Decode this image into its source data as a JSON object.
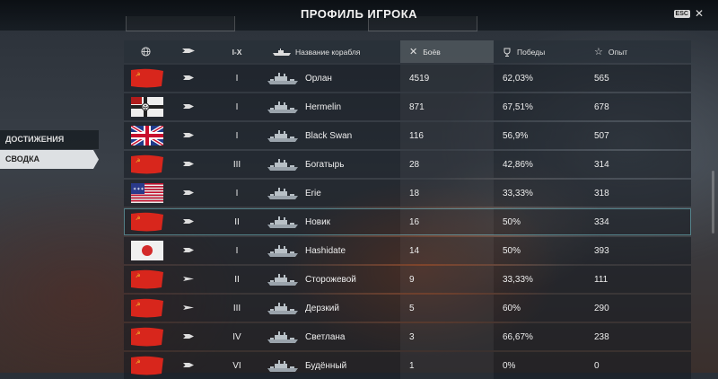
{
  "header": {
    "title": "ПРОФИЛЬ ИГРОКА",
    "esc_label": "ESC",
    "close_icon": "close-icon"
  },
  "sidebar": {
    "items": [
      {
        "label": "ДОСТИЖЕНИЯ"
      },
      {
        "label": "СВОДКА",
        "active": true
      }
    ]
  },
  "table": {
    "columns": {
      "nation": "globe-icon",
      "type": "ship-type-icon",
      "tier": "I-X",
      "ship_icon": "ship-silhouette-icon",
      "name": "Название корабля",
      "battles": "Боёв",
      "wins": "Победы",
      "xp": "Опыт"
    },
    "rows": [
      {
        "flag": "ussr",
        "type": "cruiser",
        "tier": "I",
        "name": "Орлан",
        "battles": "4519",
        "wins": "62,03%",
        "xp": "565"
      },
      {
        "flag": "germany",
        "type": "cruiser",
        "tier": "I",
        "name": "Hermelin",
        "battles": "871",
        "wins": "67,51%",
        "xp": "678"
      },
      {
        "flag": "uk",
        "type": "cruiser",
        "tier": "I",
        "name": "Black Swan",
        "battles": "116",
        "wins": "56,9%",
        "xp": "507"
      },
      {
        "flag": "ussr",
        "type": "cruiser",
        "tier": "III",
        "name": "Богатырь",
        "battles": "28",
        "wins": "42,86%",
        "xp": "314"
      },
      {
        "flag": "usa",
        "type": "cruiser",
        "tier": "I",
        "name": "Erie",
        "battles": "18",
        "wins": "33,33%",
        "xp": "318"
      },
      {
        "flag": "ussr",
        "type": "cruiser",
        "tier": "II",
        "name": "Новик",
        "battles": "16",
        "wins": "50%",
        "xp": "334"
      },
      {
        "flag": "japan",
        "type": "cruiser",
        "tier": "I",
        "name": "Hashidate",
        "battles": "14",
        "wins": "50%",
        "xp": "393"
      },
      {
        "flag": "ussr",
        "type": "destroyer",
        "tier": "II",
        "name": "Сторожевой",
        "battles": "9",
        "wins": "33,33%",
        "xp": "111"
      },
      {
        "flag": "ussr",
        "type": "destroyer",
        "tier": "III",
        "name": "Дерзкий",
        "battles": "5",
        "wins": "60%",
        "xp": "290"
      },
      {
        "flag": "ussr",
        "type": "cruiser",
        "tier": "IV",
        "name": "Светлана",
        "battles": "3",
        "wins": "66,67%",
        "xp": "238"
      },
      {
        "flag": "ussr",
        "type": "cruiser",
        "tier": "VI",
        "name": "Будённый",
        "battles": "1",
        "wins": "0%",
        "xp": "0"
      }
    ]
  },
  "colors": {
    "ussr": "#d8261c",
    "highlight": "#78c8d2"
  }
}
